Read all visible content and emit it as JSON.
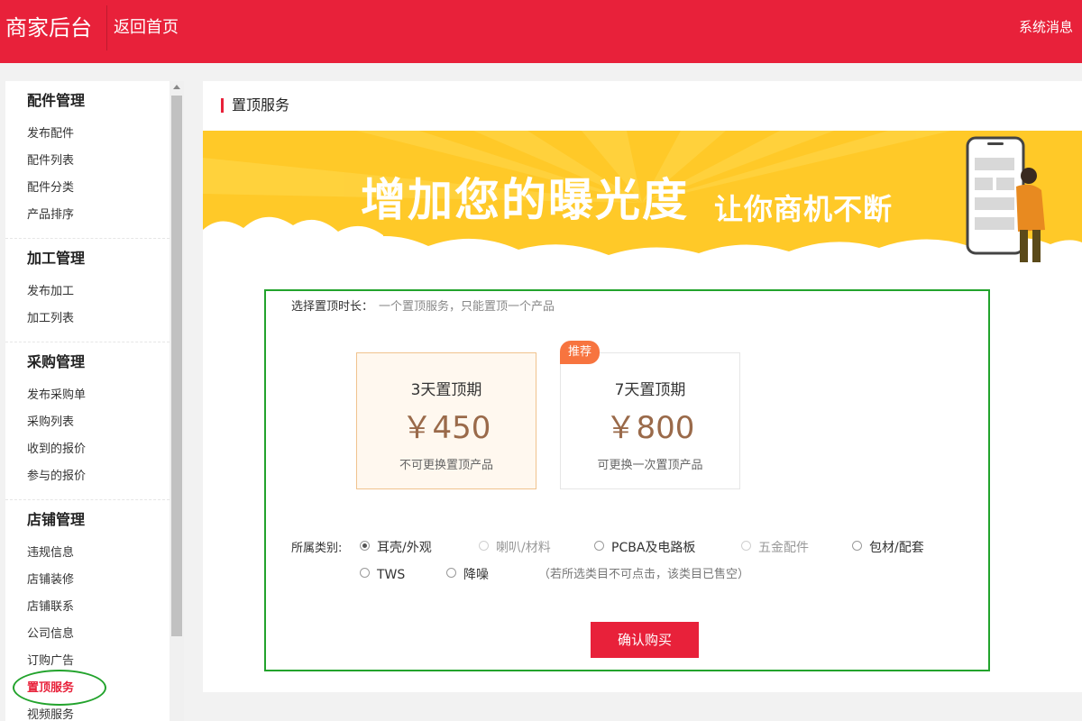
{
  "header": {
    "brand": "商家后台",
    "home_link": "返回首页",
    "system_messages": "系统消息"
  },
  "sidebar": {
    "groups": [
      {
        "title": "配件管理",
        "items": [
          "发布配件",
          "配件列表",
          "配件分类",
          "产品排序"
        ]
      },
      {
        "title": "加工管理",
        "items": [
          "发布加工",
          "加工列表"
        ]
      },
      {
        "title": "采购管理",
        "items": [
          "发布采购单",
          "采购列表",
          "收到的报价",
          "参与的报价"
        ]
      },
      {
        "title": "店铺管理",
        "items": [
          "违规信息",
          "店铺装修",
          "店铺联系",
          "公司信息",
          "订购广告",
          "置顶服务",
          "视频服务"
        ]
      }
    ],
    "active_item": "置顶服务"
  },
  "main": {
    "page_title": "置顶服务",
    "banner": {
      "title": "增加您的曝光度",
      "subtitle": "让你商机不断"
    },
    "duration_label": "选择置顶时长：",
    "duration_hint": "一个置顶服务，只能置顶一个产品",
    "plans": [
      {
        "name": "3天置顶期",
        "price": "￥450",
        "note": "不可更换置顶产品",
        "selected": true
      },
      {
        "name": "7天置顶期",
        "price": "￥800",
        "note": "可更换一次置顶产品",
        "badge": "推荐"
      }
    ],
    "category_label": "所属类别:",
    "categories": [
      {
        "label": "耳壳/外观",
        "checked": true,
        "disabled": false
      },
      {
        "label": "喇叭/材料",
        "checked": false,
        "disabled": true
      },
      {
        "label": "PCBA及电路板",
        "checked": false,
        "disabled": false
      },
      {
        "label": "五金配件",
        "checked": false,
        "disabled": true
      },
      {
        "label": "包材/配套",
        "checked": false,
        "disabled": false
      },
      {
        "label": "TWS",
        "checked": false,
        "disabled": false
      },
      {
        "label": "降噪",
        "checked": false,
        "disabled": false
      }
    ],
    "category_note": "（若所选类目不可点击，该类目已售空）",
    "confirm_button": "确认购买"
  },
  "colors": {
    "brand_red": "#e8213a",
    "banner_yellow": "#ffc928",
    "highlight_green": "#22a32c",
    "price_brown": "#9a6a4a",
    "badge_orange": "#f7743f"
  }
}
